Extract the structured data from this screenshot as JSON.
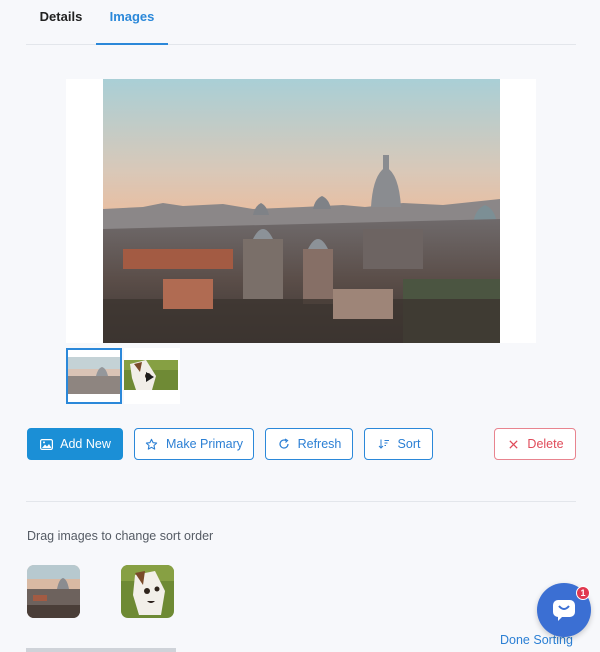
{
  "tabs": [
    {
      "label": "Details",
      "active": false
    },
    {
      "label": "Images",
      "active": true
    }
  ],
  "main_image": {
    "icon": "rome-skyline-photo"
  },
  "thumbnails": [
    {
      "icon": "rome-skyline-thumbnail",
      "selected": true
    },
    {
      "icon": "dog-video-thumbnail",
      "selected": false,
      "has_play": true
    }
  ],
  "actions": {
    "add_new": "Add New",
    "make_primary": "Make Primary",
    "refresh": "Refresh",
    "sort": "Sort",
    "delete": "Delete"
  },
  "sort_section": {
    "hint": "Drag images to change sort order",
    "done_label": "Done Sorting"
  },
  "chat": {
    "badge_count": "1"
  },
  "colors": {
    "accent": "#2b88d9",
    "primary_button": "#1b8fd6",
    "danger": "#e04b5a",
    "chat": "#3b6fd3"
  }
}
